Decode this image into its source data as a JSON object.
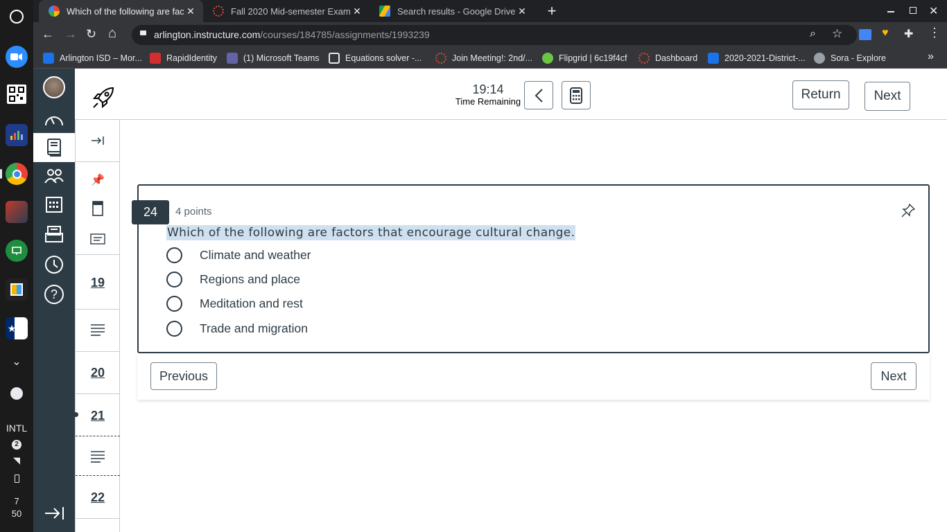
{
  "shelf": {
    "ime": "INTL",
    "notification_count": "2",
    "clock_hour": "7",
    "clock_minute": "50"
  },
  "browser": {
    "tabs": [
      {
        "title": "Which of the following are factors",
        "active": true
      },
      {
        "title": "Fall 2020 Mid-semester Exam",
        "active": false
      },
      {
        "title": "Search results - Google Drive",
        "active": false
      }
    ],
    "new_tab": "+",
    "url_host": "arlington.instructure.com",
    "url_path": "/courses/184785/assignments/1993239",
    "bookmarks": [
      "Arlington ISD – Mor...",
      "RapidIdentity",
      "(1) Microsoft Teams",
      "Equations solver -...",
      "Join Meeting!: 2nd/...",
      "Flipgrid | 6c19f4cf",
      "Dashboard",
      "2020-2021-District-...",
      "Sora - Explore"
    ],
    "more_bookmarks": "»"
  },
  "quiz_header": {
    "timer": "19:14",
    "timer_label": "Time Remaining",
    "return_label": "Return",
    "next_label": "Next"
  },
  "question_nav": {
    "numbers": [
      "19",
      "20",
      "21",
      "22"
    ]
  },
  "question": {
    "number": "24",
    "points": "4 points",
    "text": "Which of the following are factors that encourage cultural change.",
    "options": [
      "Climate and weather",
      "Regions and place",
      "Meditation and rest",
      "Trade and migration"
    ],
    "previous_label": "Previous",
    "next_label": "Next"
  },
  "colors": {
    "canvas_nav": "#2d3b45",
    "highlight": "#cfe0ef",
    "chrome_dark": "#202124",
    "chrome_toolbar": "#35363a"
  }
}
